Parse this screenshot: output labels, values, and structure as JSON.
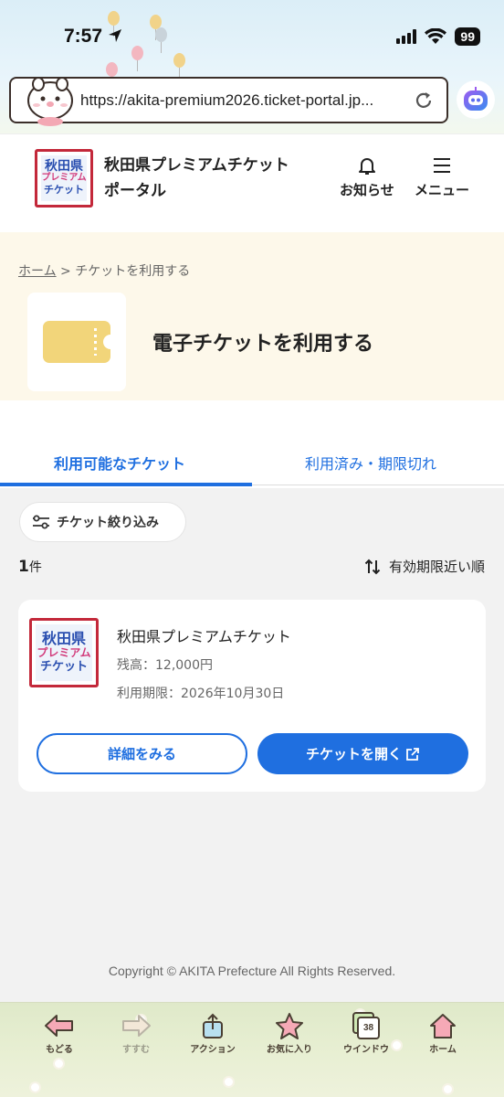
{
  "status_bar": {
    "time": "7:57",
    "battery": "99"
  },
  "browser": {
    "url": "https://akita-premium2026.ticket-portal.jp..."
  },
  "header": {
    "site_title_line1": "秋田県プレミアムチケット",
    "site_title_line2": "ポータル",
    "notifications_label": "お知らせ",
    "menu_label": "メニュー",
    "logo_text": [
      "秋田県",
      "プレミアム",
      "チケット"
    ]
  },
  "breadcrumb": {
    "home": "ホーム",
    "separator": ">",
    "current": "チケットを利用する"
  },
  "page_title": "電子チケットを利用する",
  "tabs": [
    {
      "label": "利用可能なチケット",
      "active": true
    },
    {
      "label": "利用済み・期限切れ",
      "active": false
    }
  ],
  "filter": {
    "label": "チケット絞り込み"
  },
  "results": {
    "count": "1",
    "unit": "件",
    "sort_label": "有効期限近い順"
  },
  "tickets": [
    {
      "title": "秋田県プレミアムチケット",
      "balance": "残高：12,000円",
      "expiry": "利用期限：2026年10月30日",
      "details_label": "詳細をみる",
      "open_label": "チケットを開く"
    }
  ],
  "footer": {
    "copyright": "Copyright © AKITA Prefecture All Rights Reserved."
  },
  "toolbar": {
    "back": "もどる",
    "forward": "すすむ",
    "action": "アクション",
    "favorites": "お気に入り",
    "windows": "ウインドウ",
    "window_count": "38",
    "home": "ホーム"
  },
  "colors": {
    "accent": "#1f6fe0",
    "hero_bg": "#fdf8ea",
    "ticket_icon": "#f2d57a",
    "logo_border": "#c3283a"
  }
}
